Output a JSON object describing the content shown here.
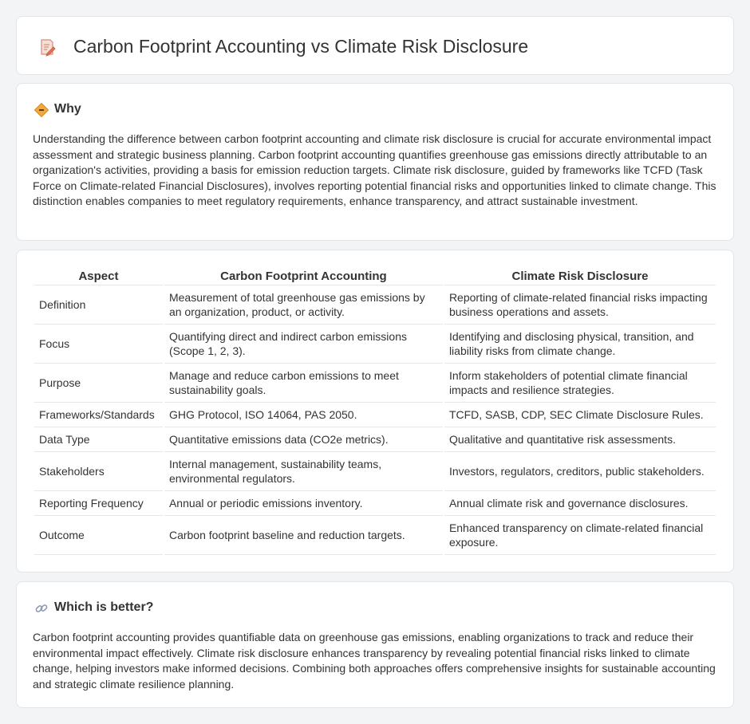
{
  "header": {
    "title": "Carbon Footprint Accounting vs Climate Risk Disclosure",
    "icon": "notepad-pencil-icon"
  },
  "why": {
    "heading": "Why",
    "icon": "diamond-sign-icon",
    "text": "Understanding the difference between carbon footprint accounting and climate risk disclosure is crucial for accurate environmental impact assessment and strategic business planning. Carbon footprint accounting quantifies greenhouse gas emissions directly attributable to an organization's activities, providing a basis for emission reduction targets. Climate risk disclosure, guided by frameworks like TCFD (Task Force on Climate-related Financial Disclosures), involves reporting potential financial risks and opportunities linked to climate change. This distinction enables companies to meet regulatory requirements, enhance transparency, and attract sustainable investment."
  },
  "table": {
    "headers": [
      "Aspect",
      "Carbon Footprint Accounting",
      "Climate Risk Disclosure"
    ],
    "rows": [
      {
        "aspect": "Definition",
        "carbon": "Measurement of total greenhouse gas emissions by an organization, product, or activity.",
        "climate": "Reporting of climate-related financial risks impacting business operations and assets."
      },
      {
        "aspect": "Focus",
        "carbon": "Quantifying direct and indirect carbon emissions (Scope 1, 2, 3).",
        "climate": "Identifying and disclosing physical, transition, and liability risks from climate change."
      },
      {
        "aspect": "Purpose",
        "carbon": "Manage and reduce carbon emissions to meet sustainability goals.",
        "climate": "Inform stakeholders of potential climate financial impacts and resilience strategies."
      },
      {
        "aspect": "Frameworks/Standards",
        "carbon": "GHG Protocol, ISO 14064, PAS 2050.",
        "climate": "TCFD, SASB, CDP, SEC Climate Disclosure Rules."
      },
      {
        "aspect": "Data Type",
        "carbon": "Quantitative emissions data (CO2e metrics).",
        "climate": "Qualitative and quantitative risk assessments."
      },
      {
        "aspect": "Stakeholders",
        "carbon": "Internal management, sustainability teams, environmental regulators.",
        "climate": "Investors, regulators, creditors, public stakeholders."
      },
      {
        "aspect": "Reporting Frequency",
        "carbon": "Annual or periodic emissions inventory.",
        "climate": "Annual climate risk and governance disclosures."
      },
      {
        "aspect": "Outcome",
        "carbon": "Carbon footprint baseline and reduction targets.",
        "climate": "Enhanced transparency on climate-related financial exposure."
      }
    ]
  },
  "better": {
    "heading": "Which is better?",
    "icon": "link-icon",
    "text": "Carbon footprint accounting provides quantifiable data on greenhouse gas emissions, enabling organizations to track and reduce their environmental impact effectively. Climate risk disclosure enhances transparency by revealing potential financial risks linked to climate change, helping investors make informed decisions. Combining both approaches offers comprehensive insights for sustainable accounting and strategic climate resilience planning."
  }
}
